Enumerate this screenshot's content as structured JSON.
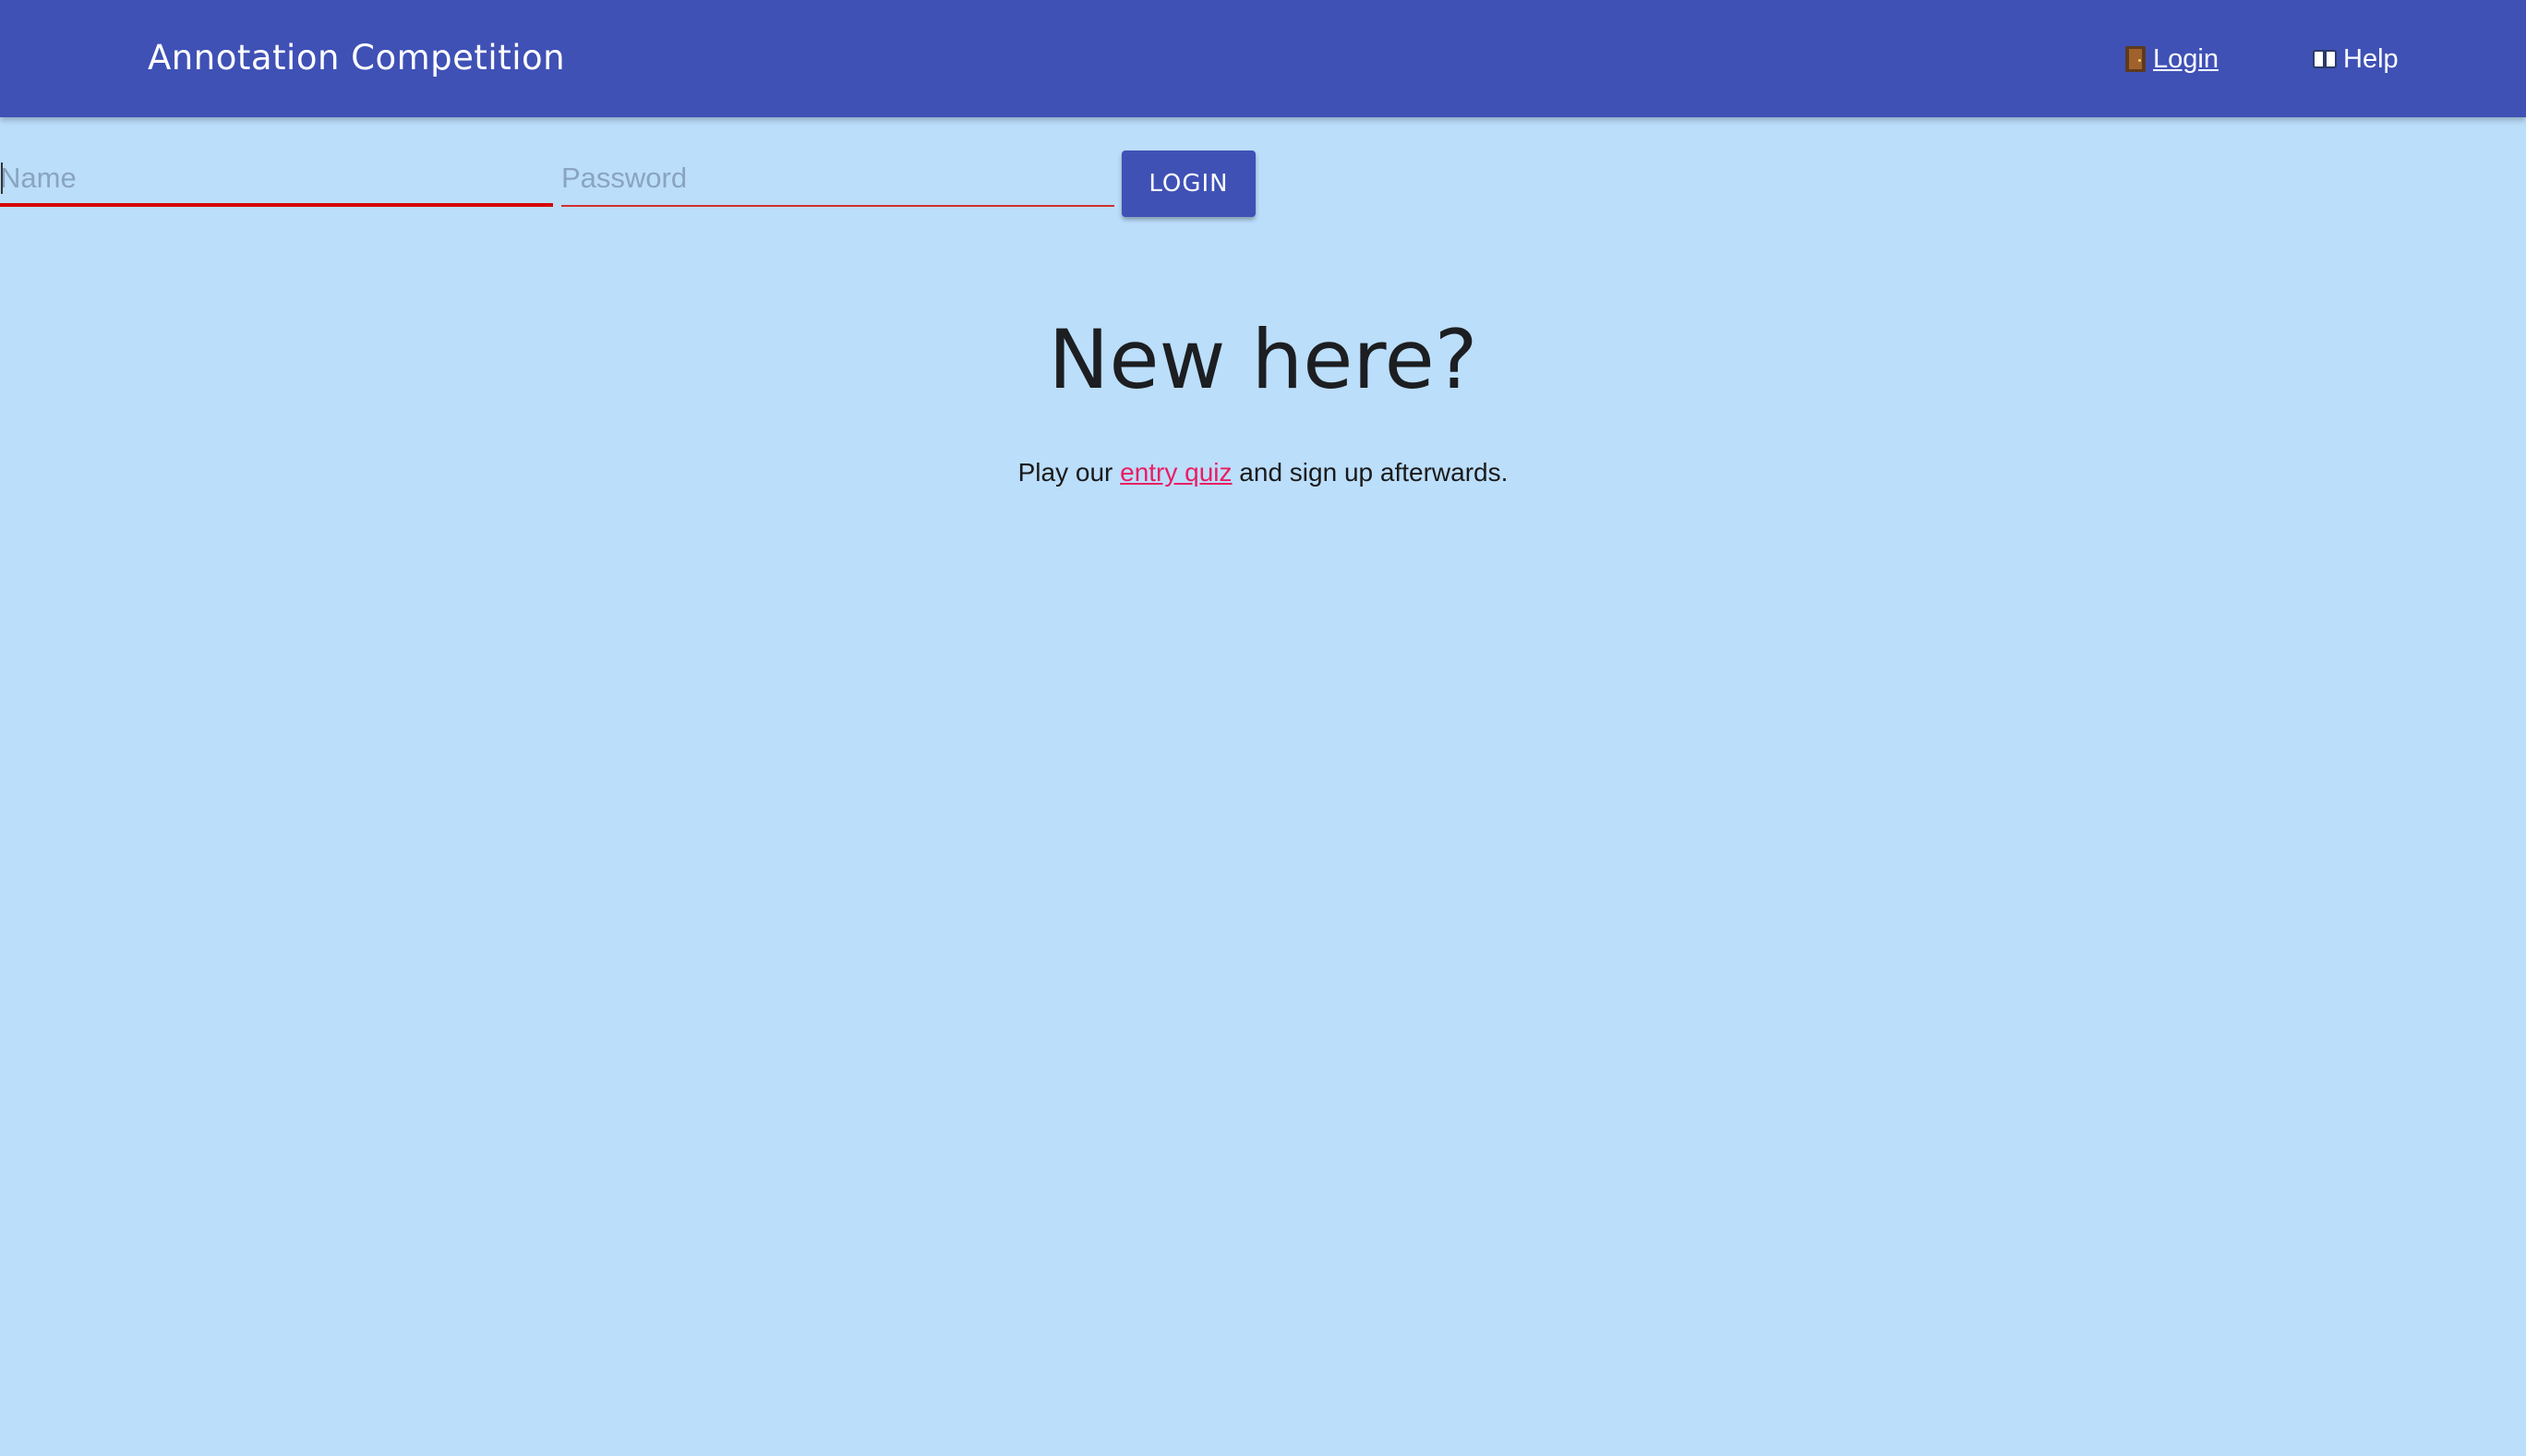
{
  "app": {
    "title": "Annotation Competition",
    "accent_color": "#3f51b5",
    "background_color": "#bbdefb"
  },
  "nav": {
    "login": {
      "icon": "door-icon",
      "label": "Login"
    },
    "help": {
      "icon": "book-icon",
      "label": "Help"
    }
  },
  "login_form": {
    "name_placeholder": "Name",
    "name_value": "",
    "password_placeholder": "Password",
    "password_value": "",
    "submit_label": "LOGIN",
    "error_color": "#d50000"
  },
  "signup_prompt": {
    "headline": "New here?",
    "text_before": "Play our ",
    "link_label": "entry quiz",
    "text_after": " and sign up afterwards.",
    "link_color": "#e91e63"
  }
}
